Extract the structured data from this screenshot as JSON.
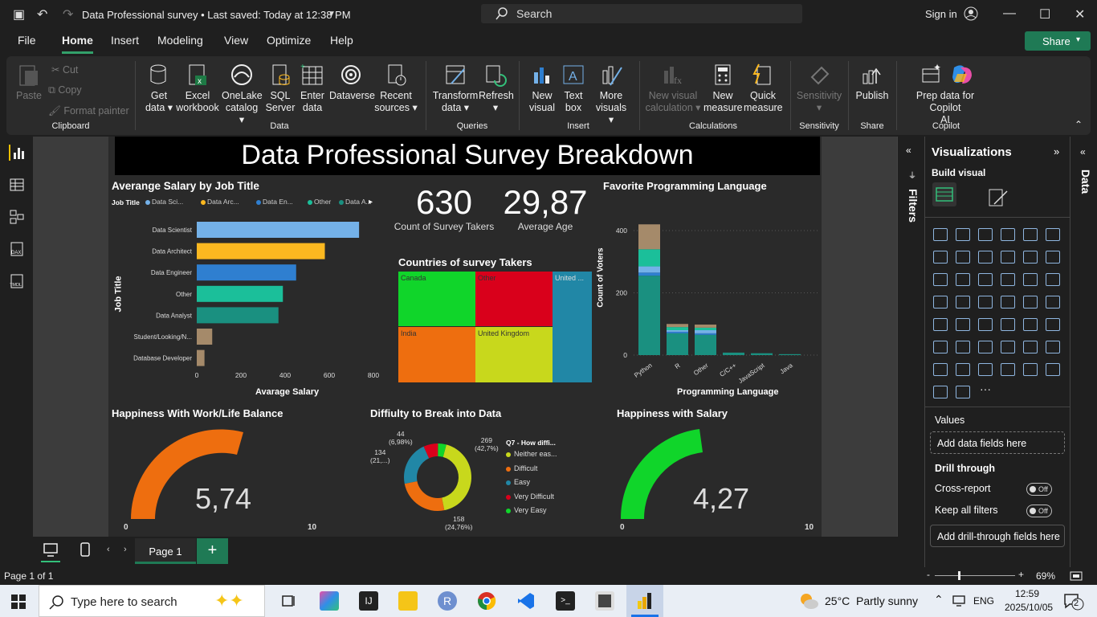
{
  "titlebar": {
    "doc_title": "Data Professional survey • Last saved: Today at 12:38 PM",
    "search_placeholder": "Search",
    "sign_in": "Sign in"
  },
  "menu": {
    "items": [
      "File",
      "Home",
      "Insert",
      "Modeling",
      "View",
      "Optimize",
      "Help"
    ],
    "active": "Home",
    "share": "Share"
  },
  "ribbon": {
    "clipboard": {
      "paste": "Paste",
      "cut": "Cut",
      "copy": "Copy",
      "format_painter": "Format painter",
      "group": "Clipboard"
    },
    "data": {
      "get_data": [
        "Get",
        "data ▾"
      ],
      "excel": [
        "Excel",
        "workbook"
      ],
      "onelake": [
        "OneLake",
        "catalog ▾"
      ],
      "sql": [
        "SQL",
        "Server"
      ],
      "enter": [
        "Enter",
        "data"
      ],
      "dataverse": [
        "Dataverse",
        ""
      ],
      "recent": [
        "Recent",
        "sources ▾"
      ],
      "group": "Data"
    },
    "queries": {
      "transform": [
        "Transform",
        "data ▾"
      ],
      "refresh": [
        "Refresh",
        "▾"
      ],
      "group": "Queries"
    },
    "insert": {
      "new_visual": [
        "New",
        "visual"
      ],
      "text_box": [
        "Text",
        "box"
      ],
      "more_visuals": [
        "More",
        "visuals ▾"
      ],
      "group": "Insert"
    },
    "calculations": {
      "new_visual_calc": [
        "New visual",
        "calculation ▾"
      ],
      "new_measure": [
        "New",
        "measure"
      ],
      "quick_measure": [
        "Quick",
        "measure"
      ],
      "group": "Calculations"
    },
    "sensitivity": {
      "label": [
        "Sensitivity",
        "▾"
      ],
      "group": "Sensitivity"
    },
    "share": {
      "publish": [
        "Publish",
        ""
      ],
      "group": "Share"
    },
    "copilot": {
      "prep": [
        "Prep data for Copilot",
        "AI"
      ],
      "group": "Copilot"
    }
  },
  "report": {
    "title": "Data Professional Survey Breakdown",
    "salary": {
      "title": "Averange Salary by Job Title",
      "legend_label": "Job Title",
      "legend": [
        {
          "name": "Data Sci...",
          "color": "#74b1e8"
        },
        {
          "name": "Data Arc...",
          "color": "#fbb820"
        },
        {
          "name": "Data En...",
          "color": "#2f7fd0"
        },
        {
          "name": "Other",
          "color": "#1bbf9a"
        },
        {
          "name": "Data A...",
          "color": "#1a9080"
        }
      ],
      "ylabel": "Job Title",
      "xlabel": "Avarage Salary",
      "ticks": [
        "0",
        "200",
        "400",
        "600",
        "800"
      ]
    },
    "card_count": {
      "value": "630",
      "label": "Count of Survey Takers"
    },
    "card_age": {
      "value": "29,87",
      "label": "Average Age"
    },
    "treemap": {
      "title": "Countries of survey Takers",
      "cells": [
        {
          "name": "Canada",
          "color": "#10d52a"
        },
        {
          "name": "Other",
          "color": "#d9001b"
        },
        {
          "name": "United ...",
          "color": "#2187a6"
        },
        {
          "name": "India",
          "color": "#ee6e0f"
        },
        {
          "name": "United Kingdom",
          "color": "#c8d81c"
        }
      ]
    },
    "lang": {
      "title": "Favorite Programming Language",
      "ylabel": "Count of Voters",
      "xlabel": "Programming Language",
      "yticks": [
        "400",
        "200",
        "0"
      ],
      "categories": [
        "Python",
        "R",
        "Other",
        "C/C++",
        "JavaScript",
        "Java"
      ]
    },
    "gauge1": {
      "title": "Happiness With Work/Life Balance",
      "value": "5,74",
      "min": "0",
      "max": "10",
      "color": "#ee6e0f"
    },
    "donut": {
      "title": "Diffiulty to Break into Data",
      "legend_title": "Q7 - How diffi...",
      "legend": [
        {
          "name": "Neither eas...",
          "color": "#c8d81c"
        },
        {
          "name": "Difficult",
          "color": "#ee6e0f"
        },
        {
          "name": "Easy",
          "color": "#2187a6"
        },
        {
          "name": "Very Difficult",
          "color": "#d9001b"
        },
        {
          "name": "Very Easy",
          "color": "#10d52a"
        }
      ],
      "labels": {
        "neither": [
          "269",
          "(42,7%)"
        ],
        "difficult": [
          "158",
          "(24,76%)"
        ],
        "easy": [
          "134",
          "(21,...)"
        ],
        "vdiff": [
          "44",
          "(6,98%)"
        ]
      }
    },
    "gauge2": {
      "title": "Happiness with Salary",
      "value": "4,27",
      "min": "0",
      "max": "10",
      "color": "#10d52a"
    }
  },
  "chart_data": [
    {
      "type": "bar",
      "title": "Averange Salary by Job Title",
      "categories": [
        "Data Scientist",
        "Data Architect",
        "Data Engineer",
        "Other",
        "Data Analyst",
        "Student/Looking/N...",
        "Database Developer"
      ],
      "values": [
        735,
        580,
        450,
        390,
        370,
        70,
        35
      ],
      "xlabel": "Avarage Salary",
      "ylabel": "Job Title",
      "xlim": [
        0,
        800
      ]
    },
    {
      "type": "bar",
      "title": "Favorite Programming Language",
      "categories": [
        "Python",
        "R",
        "Other",
        "C/C++",
        "JavaScript",
        "Java"
      ],
      "series": [
        {
          "values": [
            255,
            70,
            65,
            8,
            6,
            3
          ],
          "color": "#1a9080"
        },
        {
          "values": [
            10,
            5,
            5,
            0,
            0,
            0
          ],
          "color": "#2f7fd0"
        },
        {
          "values": [
            20,
            5,
            10,
            0,
            0,
            0
          ],
          "color": "#74b1e8"
        },
        {
          "values": [
            55,
            10,
            8,
            0,
            0,
            0
          ],
          "color": "#1bbf9a"
        },
        {
          "values": [
            80,
            10,
            10,
            0,
            0,
            0
          ],
          "color": "#a58a6a"
        }
      ],
      "xlabel": "Programming Language",
      "ylabel": "Count of Voters",
      "ylim": [
        0,
        450
      ]
    },
    {
      "type": "pie",
      "title": "Diffiulty to Break into Data",
      "categories": [
        "Neither eas...",
        "Difficult",
        "Easy",
        "Very Difficult",
        "Very Easy"
      ],
      "values": [
        269,
        158,
        134,
        44,
        25
      ]
    },
    {
      "type": "treemap",
      "title": "Countries of survey Takers",
      "categories": [
        "Canada",
        "Other",
        "United ...",
        "India",
        "United Kingdom"
      ]
    }
  ],
  "panes": {
    "filters": "Filters",
    "visualizations": "Visualizations",
    "build_visual": "Build visual",
    "values": "Values",
    "add_data": "Add data fields here",
    "drill": "Drill through",
    "cross_report": "Cross-report",
    "keep_filters": "Keep all filters",
    "off": "Off",
    "add_drill": "Add drill-through fields here",
    "data_tab": "Data"
  },
  "pagebar": {
    "page": "Page 1",
    "status": "Page 1 of 1",
    "zoom": "69%"
  },
  "taskbar": {
    "search": "Type here to search",
    "weather_temp": "25°C",
    "weather": "Partly sunny",
    "lang": "ENG",
    "time": "12:59",
    "date": "2025/10/05",
    "notif": "2"
  }
}
